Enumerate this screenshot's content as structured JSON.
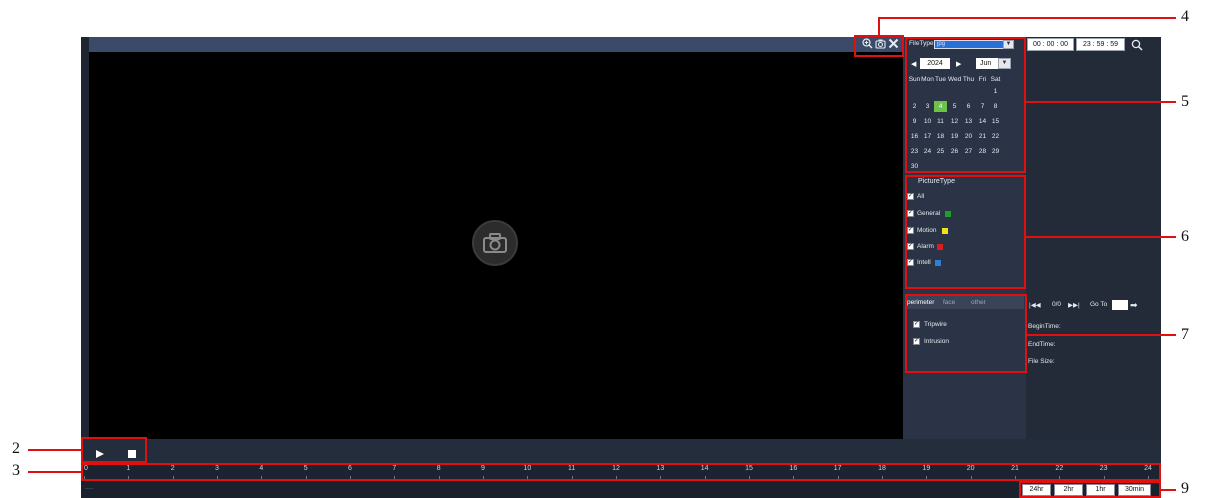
{
  "toolbar": {
    "zoom_icon": "zoom-in-icon",
    "snapshot_icon": "camera-icon",
    "close_icon": "close-icon"
  },
  "file_type": {
    "label": "FileType",
    "value": "jpg"
  },
  "calendar": {
    "year": "2024",
    "month": "Jun",
    "weekdays": [
      "Sun",
      "Mon",
      "Tue",
      "Wed",
      "Thu",
      "Fri",
      "Sat"
    ],
    "days": [
      "1",
      "2",
      "3",
      "4",
      "5",
      "6",
      "7",
      "8",
      "9",
      "10",
      "11",
      "12",
      "13",
      "14",
      "15",
      "16",
      "17",
      "18",
      "19",
      "20",
      "21",
      "22",
      "23",
      "24",
      "25",
      "26",
      "27",
      "28",
      "29",
      "30"
    ],
    "selected_day": "4"
  },
  "picture_type": {
    "title": "PictureType",
    "items": [
      {
        "label": "All",
        "checked": true,
        "color": ""
      },
      {
        "label": "General",
        "checked": true,
        "color": "#1f9d2a"
      },
      {
        "label": "Motion",
        "checked": true,
        "color": "#f2e21b"
      },
      {
        "label": "Alarm",
        "checked": true,
        "color": "#e01b1b"
      },
      {
        "label": "Intell",
        "checked": true,
        "color": "#2f7fd6"
      }
    ]
  },
  "smart_tabs": {
    "tabs": [
      "perimeter",
      "face",
      "other"
    ],
    "active": "perimeter",
    "items": [
      {
        "label": "Tripwire",
        "checked": true
      },
      {
        "label": "Intrusion",
        "checked": true
      }
    ]
  },
  "time_range": {
    "start": "00 : 00 : 00",
    "end": "23 : 59 : 59"
  },
  "paging": {
    "count": "0/0",
    "goto_label": "Go To",
    "goto_value": ""
  },
  "file_info": {
    "begin_label": "BeginTime:",
    "end_label": "EndTime:",
    "size_label": "File Size:"
  },
  "timeline": {
    "hours": [
      "0",
      "1",
      "2",
      "3",
      "4",
      "5",
      "6",
      "7",
      "8",
      "9",
      "10",
      "11",
      "12",
      "13",
      "14",
      "15",
      "16",
      "17",
      "18",
      "19",
      "20",
      "21",
      "22",
      "23",
      "24"
    ]
  },
  "zoom_buttons": [
    "24hr",
    "2hr",
    "1hr",
    "30min"
  ],
  "callouts": [
    "2",
    "3",
    "4",
    "5",
    "6",
    "7",
    "9"
  ],
  "colors": {
    "accent_selected_day": "#6dc34a",
    "callout_red": "#e01010"
  }
}
